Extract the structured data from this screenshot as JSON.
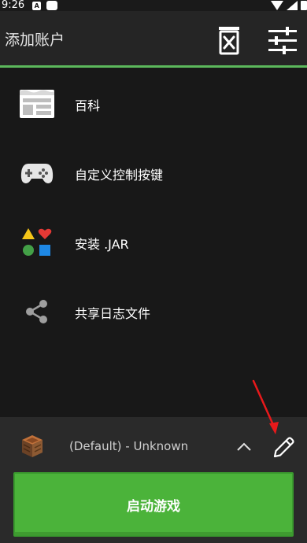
{
  "status_bar": {
    "time": "9:26",
    "notification_letter": "A"
  },
  "toolbar": {
    "title": "添加账户",
    "delete_icon": "delete-account-icon",
    "settings_icon": "sliders-settings-icon"
  },
  "menu": {
    "items": [
      {
        "label": "百科",
        "icon": "wiki-news-icon"
      },
      {
        "label": "自定义控制按键",
        "icon": "gamepad-icon"
      },
      {
        "label": "安装 .JAR",
        "icon": "shapes-icon"
      },
      {
        "label": "共享日志文件",
        "icon": "share-icon"
      }
    ]
  },
  "profile": {
    "name": "(Default) - Unknown",
    "icon": "crafting-table-icon"
  },
  "launch_button": {
    "label": "启动游戏"
  },
  "colors": {
    "accent": "#5cb85c",
    "launch": "#4bb33a",
    "annotation_arrow": "#e8191b"
  }
}
